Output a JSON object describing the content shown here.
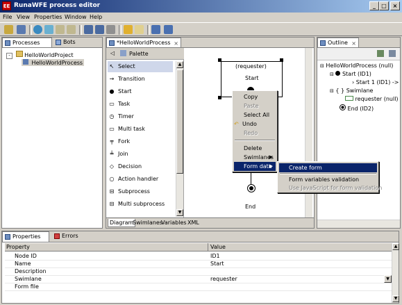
{
  "window": {
    "title": "RunaWFE process editor",
    "icon_text": "EE"
  },
  "menu": [
    "File",
    "View",
    "Properties",
    "Window",
    "Help"
  ],
  "left_panel": {
    "tabs": [
      "Processes",
      "Bots"
    ],
    "tree": [
      "HelloWorldProject",
      "HelloWorldProcess"
    ]
  },
  "editor": {
    "tab_title": "*HelloWorldProcess",
    "palette_title": "Palette",
    "palette_items": [
      "Select",
      "Transition",
      "Start",
      "Task",
      "Timer",
      "Multi task",
      "Fork",
      "Join",
      "Decision",
      "Action handler",
      "Subprocess",
      "Multi subprocess"
    ],
    "bottom_tabs": [
      "Diagram",
      "Swimlanes",
      "Variables",
      "XML"
    ],
    "diagram": {
      "start_swimlane": "(requester)",
      "start_label": "Start",
      "end_label": "End"
    }
  },
  "context_menu": {
    "items": [
      {
        "label": "Copy",
        "disabled": false
      },
      {
        "label": "Paste",
        "disabled": true
      },
      {
        "label": "Select All",
        "disabled": false
      },
      {
        "label": "Undo",
        "disabled": false
      },
      {
        "label": "Redo",
        "disabled": true
      },
      {
        "label": "Delete",
        "disabled": false
      },
      {
        "label": "Swimlanes",
        "disabled": false,
        "submenu": true
      },
      {
        "label": "Form data",
        "disabled": false,
        "submenu": true,
        "selected": true
      }
    ],
    "submenu": [
      {
        "label": "Create form",
        "selected": true,
        "disabled": false
      },
      {
        "label": "Form variables validation",
        "selected": false,
        "disabled": false
      },
      {
        "label": "Use JavaScript for form validation",
        "selected": false,
        "disabled": true
      }
    ]
  },
  "outline": {
    "tab": "Outline",
    "tree": [
      "HelloWorldProcess (null)",
      "Start (ID1)",
      "Start 1 (ID1) ->",
      "Swimlane",
      "requester (null)",
      "End (ID2)"
    ]
  },
  "properties": {
    "tabs": [
      "Properties",
      "Errors"
    ],
    "headers": [
      "Property",
      "Value"
    ],
    "rows": [
      {
        "property": "Node ID",
        "value": "ID1"
      },
      {
        "property": "Name",
        "value": "Start"
      },
      {
        "property": "Description",
        "value": ""
      },
      {
        "property": "Swimlane",
        "value": "requester"
      },
      {
        "property": "Form file",
        "value": ""
      }
    ]
  }
}
